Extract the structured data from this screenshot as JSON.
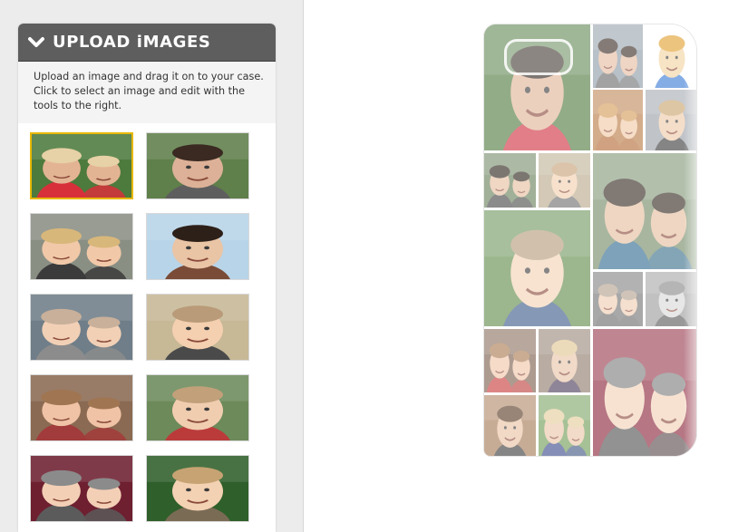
{
  "upload_panel": {
    "title": "UPLOAD iMAGES",
    "description": "Upload an image and drag it on to your case. Click to select an image and edit with the tools to the right.",
    "header_color": "#5e5e5e",
    "selected_border_color": "#e8b800",
    "thumbnails": [
      {
        "label": "family-photo-1",
        "bg": "#4d7a3d",
        "skin": "#e3b494",
        "hair": "#e7d1a6",
        "shirt": "#d8303b",
        "selected": true
      },
      {
        "label": "family-photo-2",
        "bg": "#5f7f4b",
        "skin": "#dcb197",
        "hair": "#3a2a22",
        "shirt": "#5e5e5e",
        "selected": false
      },
      {
        "label": "child-photo-1",
        "bg": "#8a8f84",
        "skin": "#f1c9a8",
        "hair": "#d8b77a",
        "shirt": "#3b3b3b",
        "selected": false
      },
      {
        "label": "selfie-photo-1",
        "bg": "#b8d4e8",
        "skin": "#e9c4a5",
        "hair": "#2d2019",
        "shirt": "#7a4b36",
        "selected": false
      },
      {
        "label": "baby-closeup-1",
        "bg": "#6f7e88",
        "skin": "#f2d0b6",
        "hair": "#c9b09a",
        "shirt": "#8c8c8c",
        "selected": false
      },
      {
        "label": "baby-lying-1",
        "bg": "#c7b896",
        "skin": "#f4cfb0",
        "hair": "#b99b79",
        "shirt": "#4a4a4a",
        "selected": false
      },
      {
        "label": "baby-sitting-1",
        "bg": "#8a6a52",
        "skin": "#f0c3a6",
        "hair": "#a07552",
        "shirt": "#a23b3b",
        "selected": false
      },
      {
        "label": "baby-lying-2",
        "bg": "#6c8a5a",
        "skin": "#f1cdb0",
        "hair": "#c1a07a",
        "shirt": "#bb3b3b",
        "selected": false
      },
      {
        "label": "baby-pram-1",
        "bg": "#6e1f30",
        "skin": "#f3cfb6",
        "hair": "#8b8b8b",
        "shirt": "#5b5b5b",
        "selected": false
      },
      {
        "label": "baby-portrait-1",
        "bg": "#2f5f2a",
        "skin": "#f3d1b3",
        "hair": "#c7a373",
        "shirt": "#7a6b55",
        "selected": false
      }
    ]
  },
  "case_preview": {
    "tiles": [
      {
        "label": "couple-photo",
        "bg": "#4f7a40",
        "skin": "#e0b496",
        "hair": "#2e231c",
        "shirt": "#cf3040"
      },
      {
        "label": "dad-baby-photo",
        "bg": "#8d9aa6",
        "skin": "#e6bca0",
        "hair": "#3a2a22",
        "shirt": "#6a6a6a"
      },
      {
        "label": "cartoon-sticker",
        "bg": "#ffffff",
        "skin": "#f2d3a0",
        "hair": "#e0a030",
        "shirt": "#3a7bd5"
      },
      {
        "label": "baby-hat-photo",
        "bg": "#b97a45",
        "skin": "#f0c8a5",
        "hair": "#d39b58",
        "shirt": "#b36a35"
      },
      {
        "label": "boy-suit-photo",
        "bg": "#9aa1a8",
        "skin": "#efcaa8",
        "hair": "#c9a36d",
        "shirt": "#3b3b3b"
      },
      {
        "label": "mum-dad-photo",
        "bg": "#68805a",
        "skin": "#e6bf9f",
        "hair": "#2d231b",
        "shirt": "#444444"
      },
      {
        "label": "baby-chair-photo",
        "bg": "#b9a98a",
        "skin": "#f2cfae",
        "hair": "#c5a074",
        "shirt": "#6f6f6f"
      },
      {
        "label": "family-group-photo",
        "bg": "#738a66",
        "skin": "#e4bd9d",
        "hair": "#332820",
        "shirt": "#2f6a8f"
      },
      {
        "label": "baby-grin-photo",
        "bg": "#5f8a4a",
        "skin": "#f3d2b3",
        "hair": "#b59c7a",
        "shirt": "#3a5a8a"
      },
      {
        "label": "baby-face-photo",
        "bg": "#737373",
        "skin": "#efcbb0",
        "hair": "#b3a08e",
        "shirt": "#6a6a6a"
      },
      {
        "label": "baby-bw-photo",
        "bg": "#9c9c9c",
        "skin": "#d8d8d8",
        "hair": "#888888",
        "shirt": "#5a5a5a"
      },
      {
        "label": "baby-red-photo",
        "bg": "#7b5e4d",
        "skin": "#f1c6a8",
        "hair": "#a87950",
        "shirt": "#c83a3a"
      },
      {
        "label": "mum-baby-photo",
        "bg": "#8e7a6a",
        "skin": "#e9c3a6",
        "hair": "#e0c690",
        "shirt": "#4b3a5a"
      },
      {
        "label": "baby-pram-large",
        "bg": "#8a2238",
        "skin": "#f2d0b6",
        "hair": "#7d7d7d",
        "shirt": "#505050"
      },
      {
        "label": "girls-dress-photo",
        "bg": "#a57a55",
        "skin": "#e8c2a3",
        "hair": "#5a3a25",
        "shirt": "#3a3a3a"
      },
      {
        "label": "mum-boy-photo",
        "bg": "#6f9b55",
        "skin": "#ebc6a7",
        "hair": "#e2cc98",
        "shirt": "#3b4a8a"
      }
    ]
  }
}
